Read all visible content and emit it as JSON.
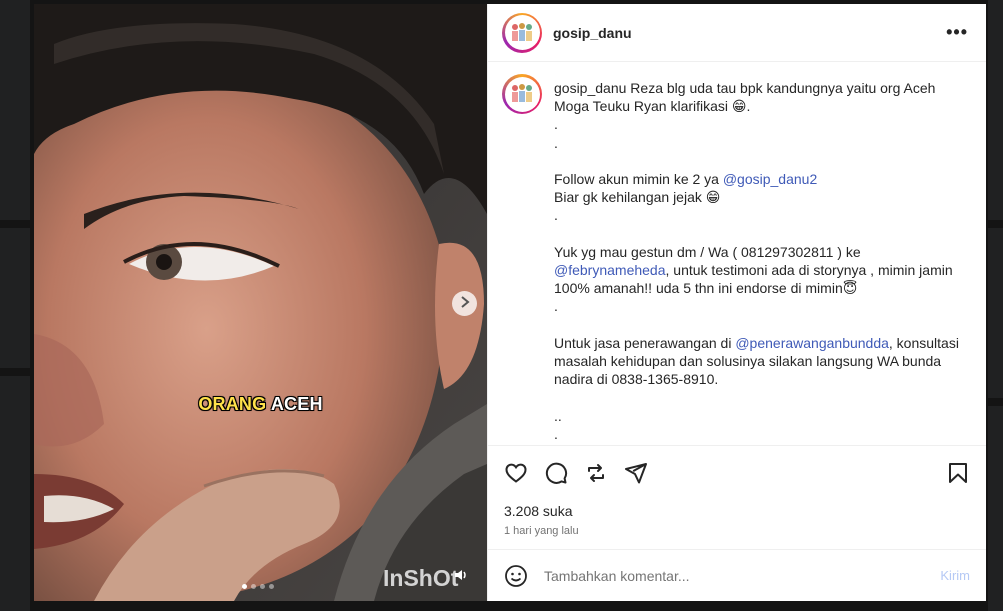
{
  "post": {
    "username": "gosip_danu",
    "more_label": "•••",
    "caption_username": "gosip_danu",
    "caption_parts": [
      {
        "text": " Reza blg uda tau bpk kandungnya yaitu org Aceh\nMoga Teuku Ryan klarifikasi 😁.\n.\n.\n\nFollow akun mimin ke 2 ya ",
        "mention": false
      },
      {
        "text": "@gosip_danu2",
        "mention": true
      },
      {
        "text": "\nBiar gk kehilangan jejak 😁\n.\n\nYuk yg mau gestun dm / Wa ( 081297302811 ) ke\n",
        "mention": false
      },
      {
        "text": "@febrynameheda",
        "mention": true
      },
      {
        "text": ", untuk testimoni ada di storynya , mimin jamin\n100% amanah!! uda 5 thn ini endorse di mimin😇\n.\n\nUntuk jasa penerawangan di ",
        "mention": false
      },
      {
        "text": "@penerawanganbundda",
        "mention": true
      },
      {
        "text": ", konsultasi\nmasalah kehidupan dan solusinya silakan langsung WA bunda\nnadira di 0838-1365-8910.\n\n..\n.",
        "mention": false
      }
    ],
    "likes": "3.208 suka",
    "time_ago": "1 hari yang lalu",
    "comment_placeholder": "Tambahkan komentar...",
    "post_button": "Kirim"
  },
  "media": {
    "overlay_word1": "ORANG",
    "overlay_word2": "ACEH",
    "watermark": "InShOt",
    "carousel_count": 4,
    "carousel_active": 0
  },
  "icons": {
    "like": "heart-icon",
    "comment": "comment-icon",
    "share": "repost-icon",
    "send": "send-icon",
    "save": "bookmark-icon",
    "emoji": "smile-icon",
    "next": "chevron-right-icon",
    "sound": "speaker-icon"
  },
  "colors": {
    "mention": "#3f5ab7",
    "post_button": "#b5c9f5",
    "subtle_text": "#737373"
  }
}
